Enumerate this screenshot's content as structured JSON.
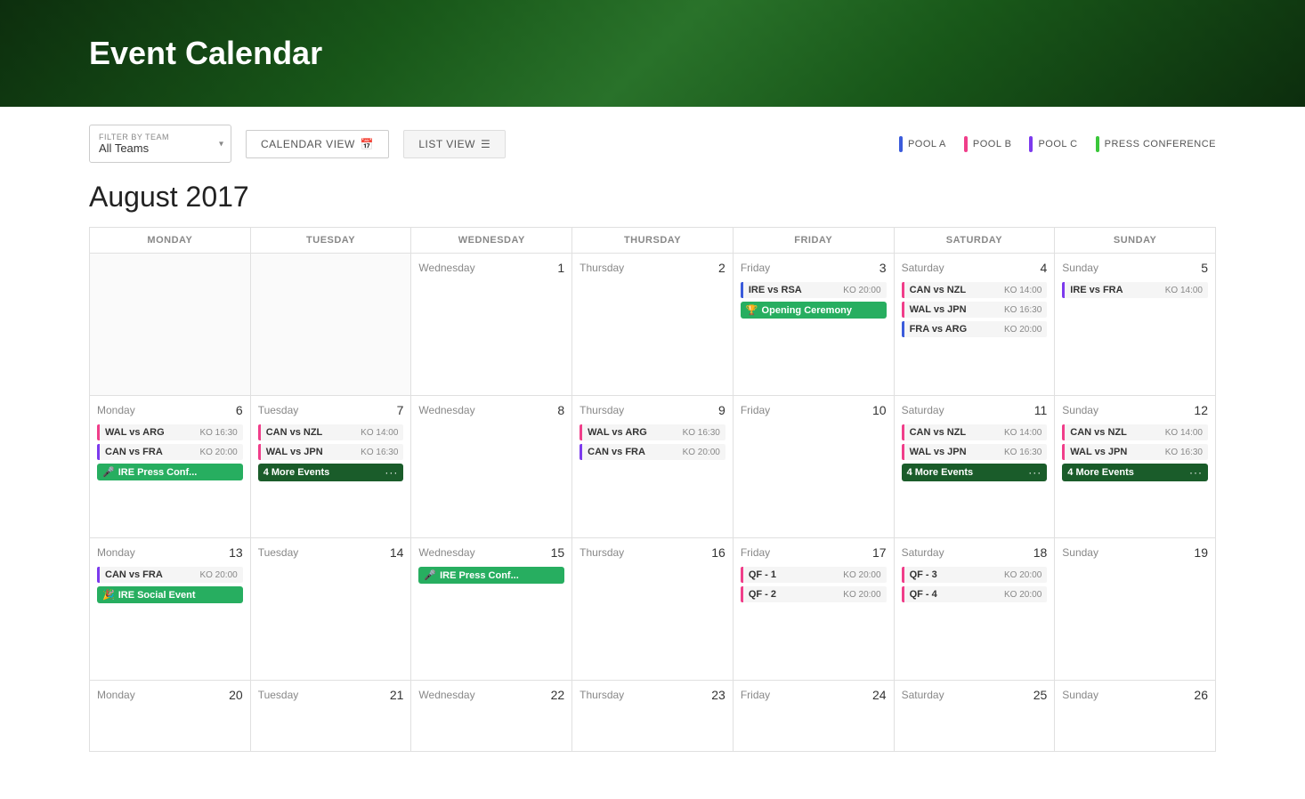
{
  "header": {
    "title": "Event Calendar"
  },
  "toolbar": {
    "filter_label": "FILTER BY TEAM",
    "filter_value": "All Teams",
    "calendar_view_label": "CALENDAR VIEW",
    "list_view_label": "LIST VIEW"
  },
  "legend": {
    "items": [
      {
        "id": "pool-a",
        "label": "POOL A",
        "color": "#3b5bdb"
      },
      {
        "id": "pool-b",
        "label": "POOL B",
        "color": "#f03e8a"
      },
      {
        "id": "pool-c",
        "label": "POOL C",
        "color": "#7c3aed"
      },
      {
        "id": "press",
        "label": "PRESS CONFERENCE",
        "color": "#3ac73a"
      }
    ]
  },
  "month": "August 2017",
  "day_headers": [
    "MONDAY",
    "TUESDAY",
    "WEDNESDAY",
    "THURSDAY",
    "FRIDAY",
    "SATURDAY",
    "SUNDAY"
  ],
  "weeks": [
    {
      "days": [
        {
          "empty": true
        },
        {
          "empty": true
        },
        {
          "name": "Wednesday",
          "num": 1,
          "events": []
        },
        {
          "name": "Thursday",
          "num": 2,
          "events": []
        },
        {
          "name": "Friday",
          "num": 3,
          "events": [
            {
              "type": "match",
              "pool": "pool-a",
              "label": "IRE vs RSA",
              "time": "KO 20:00"
            },
            {
              "type": "opening",
              "label": "Opening Ceremony",
              "icon": "🏆"
            }
          ]
        },
        {
          "name": "Saturday",
          "num": 4,
          "events": [
            {
              "type": "match",
              "pool": "pool-b",
              "label": "CAN vs NZL",
              "time": "KO 14:00"
            },
            {
              "type": "match",
              "pool": "pool-b",
              "label": "WAL vs JPN",
              "time": "KO 16:30"
            },
            {
              "type": "match",
              "pool": "pool-a",
              "label": "FRA vs ARG",
              "time": "KO 20:00"
            }
          ]
        },
        {
          "name": "Sunday",
          "num": 5,
          "events": [
            {
              "type": "match",
              "pool": "pool-c",
              "label": "IRE vs FRA",
              "time": "KO 14:00"
            }
          ]
        }
      ]
    },
    {
      "days": [
        {
          "name": "Monday",
          "num": 6,
          "events": [
            {
              "type": "match",
              "pool": "pool-b",
              "label": "WAL vs ARG",
              "time": "KO 16:30"
            },
            {
              "type": "match",
              "pool": "pool-c",
              "label": "CAN vs FRA",
              "time": "KO 20:00"
            },
            {
              "type": "press",
              "label": "IRE Press Conf...",
              "icon": "🎤"
            }
          ]
        },
        {
          "name": "Tuesday",
          "num": 7,
          "events": [
            {
              "type": "match",
              "pool": "pool-b",
              "label": "CAN vs NZL",
              "time": "KO 14:00"
            },
            {
              "type": "match",
              "pool": "pool-b",
              "label": "WAL vs JPN",
              "time": "KO 16:30"
            },
            {
              "type": "more",
              "label": "4 More Events"
            }
          ]
        },
        {
          "name": "Wednesday",
          "num": 8,
          "events": []
        },
        {
          "name": "Thursday",
          "num": 9,
          "events": [
            {
              "type": "match",
              "pool": "pool-b",
              "label": "WAL vs ARG",
              "time": "KO 16:30"
            },
            {
              "type": "match",
              "pool": "pool-c",
              "label": "CAN vs FRA",
              "time": "KO 20:00"
            }
          ]
        },
        {
          "name": "Friday",
          "num": 10,
          "events": []
        },
        {
          "name": "Saturday",
          "num": 11,
          "events": [
            {
              "type": "match",
              "pool": "pool-b",
              "label": "CAN vs NZL",
              "time": "KO 14:00"
            },
            {
              "type": "match",
              "pool": "pool-b",
              "label": "WAL vs JPN",
              "time": "KO 16:30"
            },
            {
              "type": "more",
              "label": "4 More Events"
            }
          ]
        },
        {
          "name": "Sunday",
          "num": 12,
          "events": [
            {
              "type": "match",
              "pool": "pool-b",
              "label": "CAN vs NZL",
              "time": "KO 14:00"
            },
            {
              "type": "match",
              "pool": "pool-b",
              "label": "WAL vs JPN",
              "time": "KO 16:30"
            },
            {
              "type": "more",
              "label": "4 More Events"
            }
          ]
        }
      ]
    },
    {
      "days": [
        {
          "name": "Monday",
          "num": 13,
          "events": [
            {
              "type": "match",
              "pool": "pool-c",
              "label": "CAN vs FRA",
              "time": "KO 20:00"
            },
            {
              "type": "social",
              "label": "IRE Social Event",
              "icon": "🎉"
            }
          ]
        },
        {
          "name": "Tuesday",
          "num": 14,
          "events": []
        },
        {
          "name": "Wednesday",
          "num": 15,
          "events": [
            {
              "type": "press",
              "label": "IRE Press Conf...",
              "icon": "🎤"
            }
          ]
        },
        {
          "name": "Thursday",
          "num": 16,
          "events": []
        },
        {
          "name": "Friday",
          "num": 17,
          "events": [
            {
              "type": "match",
              "pool": "pool-b",
              "label": "QF - 1",
              "time": "KO 20:00"
            },
            {
              "type": "match",
              "pool": "pool-b",
              "label": "QF - 2",
              "time": "KO 20:00"
            }
          ]
        },
        {
          "name": "Saturday",
          "num": 18,
          "events": [
            {
              "type": "match",
              "pool": "pool-b",
              "label": "QF - 3",
              "time": "KO 20:00"
            },
            {
              "type": "match",
              "pool": "pool-b",
              "label": "QF - 4",
              "time": "KO 20:00"
            }
          ]
        },
        {
          "name": "Sunday",
          "num": 19,
          "events": []
        }
      ]
    },
    {
      "days": [
        {
          "name": "Monday",
          "num": 20,
          "events": [],
          "partial": true
        },
        {
          "name": "Tuesday",
          "num": 21,
          "events": [],
          "partial": true
        },
        {
          "name": "Wednesday",
          "num": 22,
          "events": [],
          "partial": true
        },
        {
          "name": "Thursday",
          "num": 23,
          "events": [],
          "partial": true
        },
        {
          "name": "Friday",
          "num": 24,
          "events": [],
          "partial": true
        },
        {
          "name": "Saturday",
          "num": 25,
          "events": [],
          "partial": true
        },
        {
          "name": "Sunday",
          "num": 26,
          "events": [],
          "partial": true
        }
      ]
    }
  ]
}
